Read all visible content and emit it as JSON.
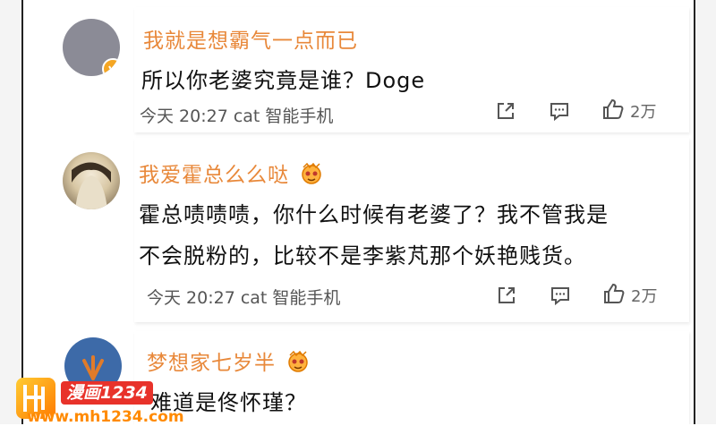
{
  "comments": [
    {
      "username": "我就是想霸气一点而已",
      "content_lines": [
        "所以你老婆究竟是谁？Doge"
      ],
      "meta": "今天 20:27 cat 智能手机",
      "likes": "2万",
      "verified": true
    },
    {
      "username": "我爱霍总么么哒",
      "content_lines": [
        "霍总啧啧啧，你什么时候有老婆了？我不管我是",
        "不会脱粉的，比较不是李紫芃那个妖艳贱货。"
      ],
      "meta": "今天 20:27 cat 智能手机",
      "likes": "2万",
      "verified": false
    },
    {
      "username": "梦想家七岁半",
      "content_lines": [
        "难道是佟怀瑾？"
      ],
      "verified": false
    }
  ],
  "icons": {
    "share": "share-icon",
    "comment": "comment-icon",
    "like": "thumbs-up-icon",
    "vip": "vip-emoji-icon"
  },
  "watermark": {
    "site_name": "漫画1234",
    "url": "www.mh1234.com"
  },
  "colors": {
    "username": "#e8883a",
    "badge": "#f5a623",
    "watermark_red": "#e8322a",
    "watermark_orange": "#ff8a00"
  }
}
